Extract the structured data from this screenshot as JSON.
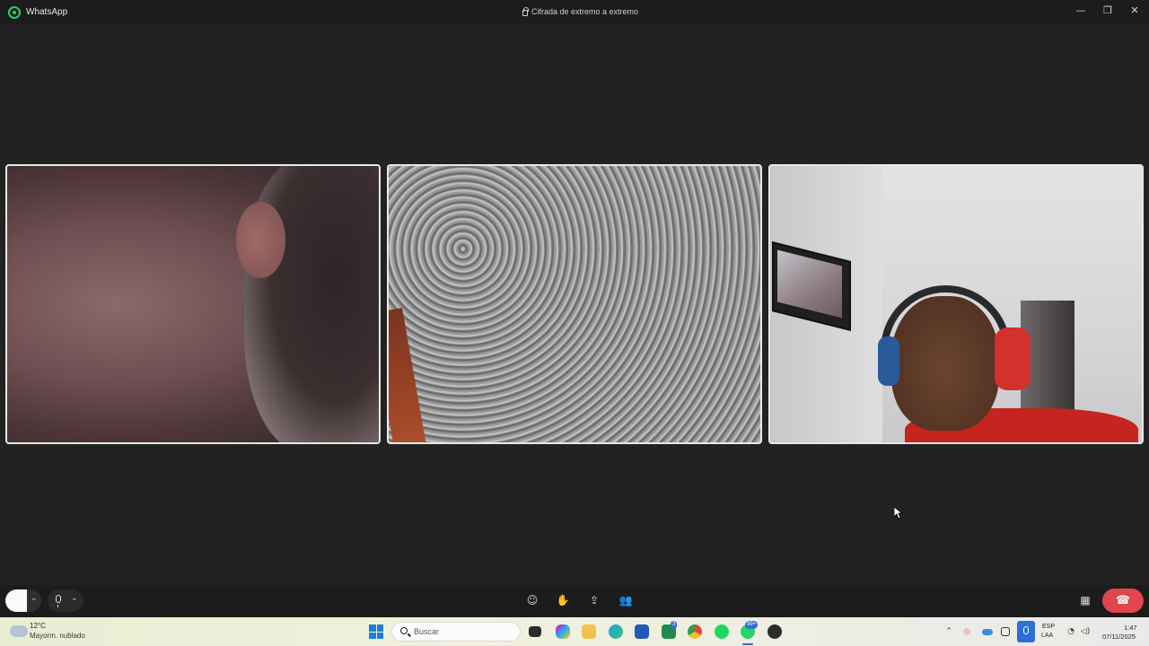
{
  "titlebar": {
    "app_name": "WhatsApp",
    "encryption_text": "Cifrada de extremo a extremo",
    "minimize": "—",
    "maximize": "❐",
    "close": "✕"
  },
  "video_tiles": [
    {
      "name": "participant-1-video"
    },
    {
      "name": "participant-2-video"
    },
    {
      "name": "participant-3-video"
    }
  ],
  "controls": {
    "camera_chevron": "⌄",
    "mic_chevron": "⌄",
    "emoji_icon": "☺",
    "raise_hand_icon": "✋",
    "share_screen_icon": "⇪",
    "participants_icon": "👥",
    "layout_icon": "▦",
    "end_call_icon": "☎",
    "end_call_color": "#e0464b"
  },
  "taskbar": {
    "weather_temp": "12°C",
    "weather_desc": "Mayorm. nublado",
    "search_placeholder": "Buscar",
    "badge_3": "3",
    "badge_whatsapp": "99+",
    "lang_code": "ESP",
    "lang_region": "LAA",
    "time": "1:47",
    "date": "07/11/2025",
    "tray_up": "⌃",
    "tray_wifi": "◔",
    "tray_volume": "◁)"
  }
}
